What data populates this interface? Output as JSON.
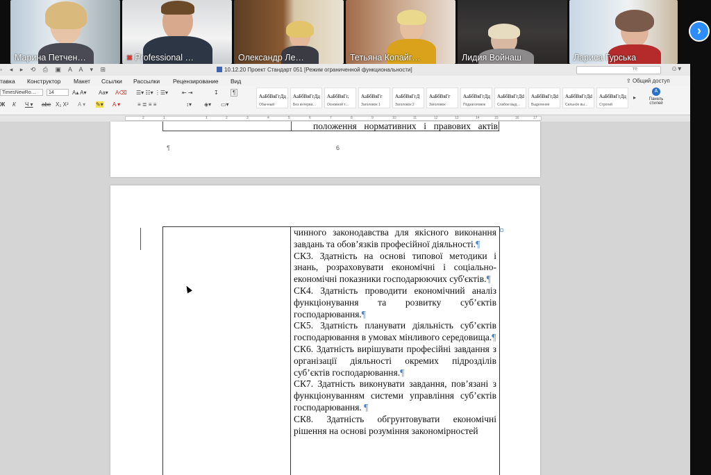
{
  "participants": [
    {
      "name": "Марина Петчен…",
      "muted": false
    },
    {
      "name": "Professional …",
      "muted": true
    },
    {
      "name": "Олександр Ле…",
      "muted": false
    },
    {
      "name": "Тетьяна Копайг…",
      "muted": false
    },
    {
      "name": "Лидия Войнаш",
      "muted": false,
      "active": true
    },
    {
      "name": "Лариса Гурська",
      "muted": false
    }
  ],
  "strip": {
    "next_icon": "›"
  },
  "word": {
    "title": "10.12.20 Проект Стандарт 051 [Режим ограниченной функциональности]",
    "search_placeholder": "те",
    "share_label": "Общий доступ",
    "tabs": [
      "тавка",
      "Конструктор",
      "Макет",
      "Ссылки",
      "Рассылки",
      "Рецензирование",
      "Вид"
    ],
    "font_name": "TimesNewRo…",
    "font_size": "14",
    "styles": [
      {
        "sample": "АаБбВвГгДд",
        "label": "Обычный"
      },
      {
        "sample": "АаБбВвГгДд",
        "label": "Без интерва…"
      },
      {
        "sample": "АаБбВвГг,",
        "label": "Основной т…"
      },
      {
        "sample": "АаБбВвГг",
        "label": "Заголовок 1"
      },
      {
        "sample": "АаБбВвГгД",
        "label": "Заголовок 2"
      },
      {
        "sample": "АаБбВвГг",
        "label": "Заголовок"
      },
      {
        "sample": "АаБбВвГгДд",
        "label": "Подзаголовок"
      },
      {
        "sample": "АаБбВвГгДd",
        "label": "Слабое выд…"
      },
      {
        "sample": "АаБбВвГгДd",
        "label": "Выделение"
      },
      {
        "sample": "АаБбВвГгДd",
        "label": "Сильное вы…"
      },
      {
        "sample": "АаБбВвГгДд",
        "label": "Строгий"
      }
    ],
    "panel_label": "Панель стилей",
    "ruler_ticks": [
      "2",
      "1",
      "1",
      "2",
      "3",
      "4",
      "5",
      "6",
      "7",
      "8",
      "9",
      "10",
      "11",
      "12",
      "13",
      "14",
      "15",
      "16",
      "17",
      "18"
    ]
  },
  "document": {
    "page1_line": "положення нормативних і правових актів",
    "page1_pilcrow": "¶",
    "page_number": "6",
    "paragraphs": [
      {
        "text": "чинного законодавства для якісного виконання завдань та обов’язків професійної діяльності.",
        "mark": "¶"
      },
      {
        "text": "СК3. Здатність на основі типової методики і знань, розраховувати економічні і соціально-економічні показники господарюючих суб'єктів.",
        "mark": "¶"
      },
      {
        "text": "СК4. Здатність проводити економічний аналіз функціонування та розвитку суб’єктів господарювання.",
        "mark": "¶"
      },
      {
        "text": "СК5. Здатність планувати діяльність суб’єктів господарювання в умовах мінливого середовища.",
        "mark": "¶"
      },
      {
        "text": "СК6. Здатність вирішувати професійні завдання з організації діяльності окремих підрозділів суб’єктів господарювання.",
        "mark": "¶"
      },
      {
        "text": "СК7. Здатність виконувати завдання, пов’язані з функціонуванням системи управління суб’єктів господарювання. ",
        "mark": "¶"
      },
      {
        "text": "СК8. Здатність обгрунтовувати економічні рішення на основі розуміння закономірностей",
        "mark": ""
      }
    ]
  }
}
